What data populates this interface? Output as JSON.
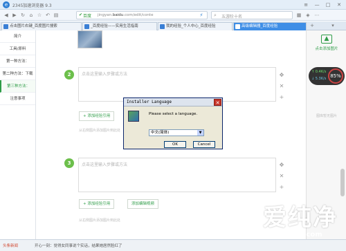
{
  "window": {
    "title": "2345加速浏览器 9.3",
    "controls": [
      "≡",
      "—",
      "□",
      "✕"
    ]
  },
  "addressbar": {
    "secure_label": "百度",
    "url_host": "jingyan.",
    "url_domain": "baidu",
    "url_rest": ".com/edit/conte",
    "search_placeholder": "五游阶十名"
  },
  "tabs": [
    {
      "label": "点击图片右键_百度图片搜索",
      "active": false
    },
    {
      "label": "_百度经验——实用生活指南",
      "active": false
    },
    {
      "label": "我的经验_个人中心_百度经验",
      "active": false
    },
    {
      "label": "高级编辑器_百度经验",
      "active": true
    }
  ],
  "sidebar": {
    "items": [
      {
        "label": "简介",
        "active": false
      },
      {
        "label": "工具/原料",
        "active": false
      },
      {
        "label": "第一种方法：",
        "active": false
      },
      {
        "label": "第二种方法：下载",
        "active": false
      },
      {
        "label": "第三种方法：",
        "active": true
      },
      {
        "label": "注意事项",
        "active": false
      }
    ]
  },
  "steps": [
    {
      "number": "2",
      "placeholder": "点击这里输入步骤或方法"
    },
    {
      "number": "3",
      "placeholder": "点击这里输入步骤或方法"
    }
  ],
  "step_actions": {
    "add_quote": "+ 添加经验引用",
    "add_video": "添加编辑视频",
    "hint": "从右侧图片添加图片到此处"
  },
  "rightpanel": {
    "add_image_label": "点击添加图片",
    "no_image_label": "图库暂无图片"
  },
  "speed_widget": {
    "up": "0.4K/s",
    "down": "5.3K/s",
    "percent": "85%"
  },
  "dialog": {
    "title": "Installer Language",
    "message": "Please select a language.",
    "selected_language": "中文(简体)",
    "ok": "OK",
    "cancel": "Cancel"
  },
  "logo": {
    "chinese": "爱纯净",
    "english": "aichunjing.com"
  },
  "statusbar": {
    "news_label": "头条新闻",
    "message": "开心一刻：觉得女同事说个实话，结果她居然脸红了"
  },
  "colors": {
    "accent_green": "#6cbf4b",
    "tab_active": "#3f8ee6",
    "dialog_border": "#0a246a"
  }
}
